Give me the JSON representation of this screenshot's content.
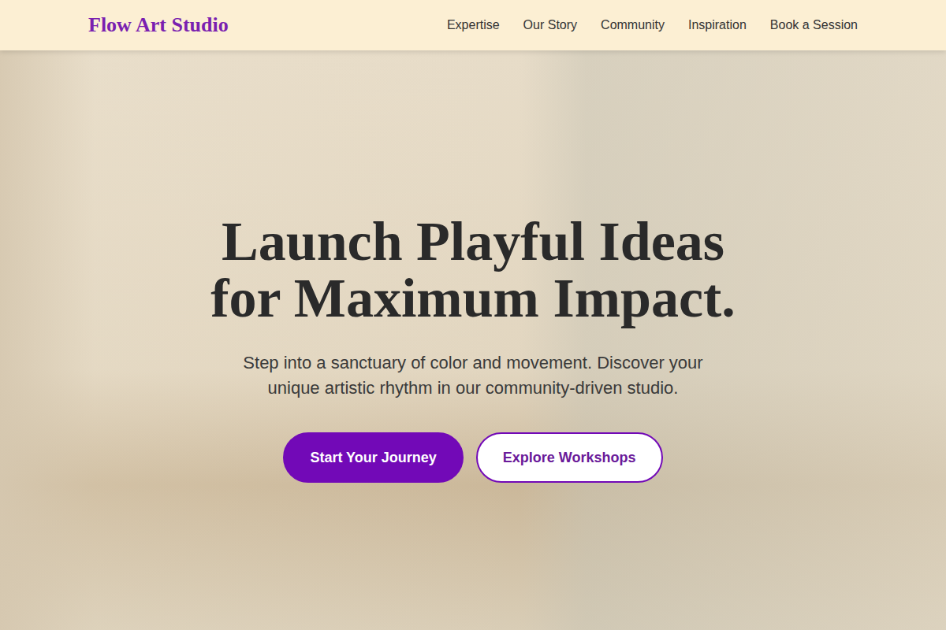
{
  "brand": "Flow Art Studio",
  "nav": [
    {
      "label": "Expertise"
    },
    {
      "label": "Our Story"
    },
    {
      "label": "Community"
    },
    {
      "label": "Inspiration"
    },
    {
      "label": "Book a Session"
    }
  ],
  "hero": {
    "title_lines": [
      "Launch Playful Ideas",
      "for Maximum Impact."
    ],
    "subtitle": "Step into a sanctuary of color and movement. Discover your unique artistic rhythm in our community-driven studio.",
    "buttons": [
      {
        "label": "Start Your Journey",
        "kind": "primary"
      },
      {
        "label": "Explore Workshops",
        "kind": "outline"
      }
    ]
  }
}
